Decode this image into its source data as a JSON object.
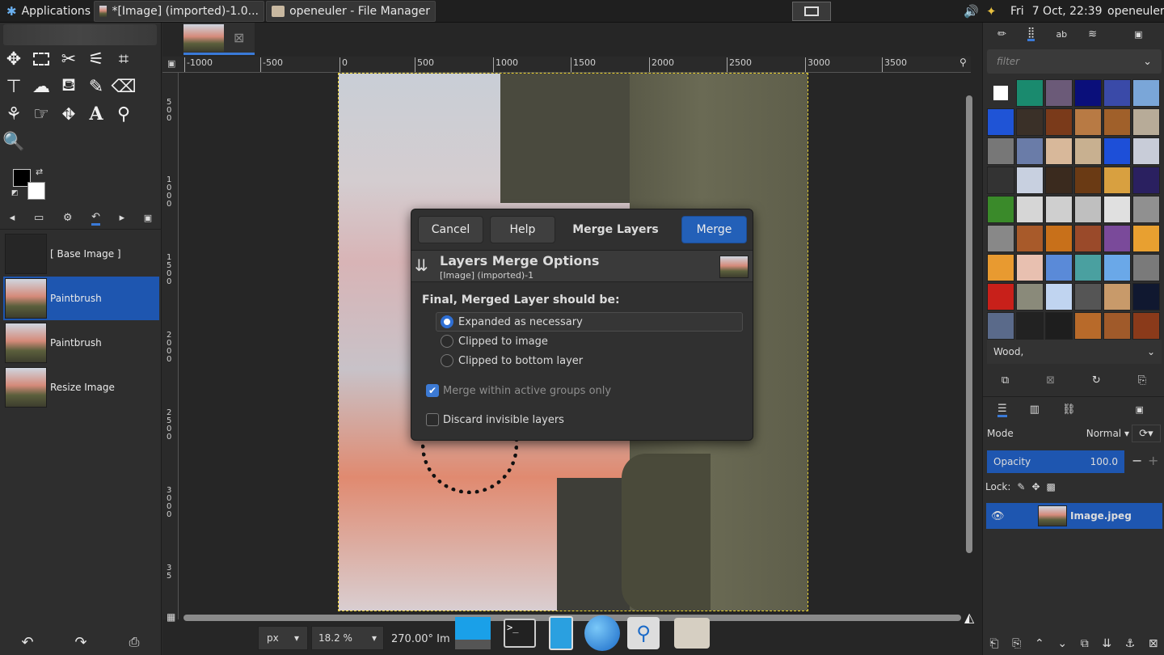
{
  "taskbar": {
    "applications": "Applications",
    "window1": "*[Image] (imported)-1.0...",
    "window2": "openeuler - File Manager",
    "clock_day": "Fri",
    "clock": "7 Oct, 22:39",
    "user": "openeuler"
  },
  "canvas": {
    "ruler_labels": [
      "-1000",
      "-500",
      "0",
      "500",
      "1000",
      "1500",
      "2000",
      "2500",
      "3000",
      "3500"
    ],
    "vruler_labels": [
      "5\n0\n0",
      "1\n0\n0\n0",
      "1\n5\n0\n0",
      "2\n0\n0\n0",
      "2\n5\n0\n0",
      "3\n0\n0\n0",
      "3\n5"
    ]
  },
  "history": {
    "items": [
      {
        "label": "[ Base Image ]",
        "selected": false
      },
      {
        "label": "Paintbrush",
        "selected": true
      },
      {
        "label": "Paintbrush",
        "selected": false
      },
      {
        "label": "Resize Image",
        "selected": false
      }
    ]
  },
  "statusbar": {
    "unit": "px",
    "zoom": "18.2 %",
    "info": "270.00° Im"
  },
  "dialog": {
    "cancel": "Cancel",
    "help": "Help",
    "title": "Merge Layers",
    "merge": "Merge",
    "header_title": "Layers Merge Options",
    "header_sub": "[Image] (imported)-1",
    "section_label": "Final, Merged Layer should be:",
    "options": [
      {
        "label": "Expanded as necessary",
        "checked": true
      },
      {
        "label": "Clipped to image",
        "checked": false
      },
      {
        "label": "Clipped to bottom layer",
        "checked": false
      }
    ],
    "merge_groups": "Merge within active groups only",
    "discard": "Discard invisible layers"
  },
  "patterns": {
    "filter_placeholder": "filter",
    "selected": "Wood,",
    "colors": [
      "#ffffff",
      "#1a8a6e",
      "#6b5a78",
      "#0a0f7a",
      "#3a4aa8",
      "#7aa6d8",
      "#1f54d6",
      "#3a3028",
      "#7a3a1a",
      "#b87a44",
      "#a0602a",
      "#b7ab98",
      "#777777",
      "#6a7ca8",
      "#d8b89a",
      "#c8b090",
      "#1d4fd8",
      "#c8ccd8",
      "#333333",
      "#c8d0e0",
      "#3a2a1e",
      "#6a3a14",
      "#d8a040",
      "#2a2060",
      "#3a8a2a",
      "#d6d6d6",
      "#cfcfcf",
      "#bfbfbf",
      "#e0e0e0",
      "#909090",
      "#888888",
      "#a85a2a",
      "#c8701a",
      "#9a4a2a",
      "#7a4a9a",
      "#e8a030",
      "#e89a30",
      "#e8c0b0",
      "#5a8ad8",
      "#4aa0a0",
      "#6aa8e8",
      "#7a7a7a",
      "#c8201a",
      "#8a8a7a",
      "#c0d4f0",
      "#555555",
      "#c89a6a",
      "#101830",
      "#5a6a8a",
      "#222222",
      "#1e1e1e",
      "#b86a2a",
      "#a05a2a",
      "#8a3a1a"
    ]
  },
  "layers": {
    "mode_label": "Mode",
    "mode_value": "Normal",
    "opacity_label": "Opacity",
    "opacity_value": "100.0",
    "lock_label": "Lock:",
    "layer_name": "Image.jpeg"
  }
}
